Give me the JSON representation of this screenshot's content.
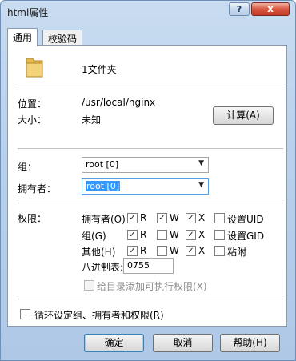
{
  "window": {
    "title": "html属性",
    "help_label": "?",
    "close_label": "x"
  },
  "tabs": [
    {
      "label": "通用"
    },
    {
      "label": "校验码"
    }
  ],
  "general": {
    "file_name": "1文件夹",
    "location_label": "位置：",
    "location_value": "/usr/local/nginx",
    "size_label": "大小：",
    "size_value": "未知",
    "calc_button": "计算(A)"
  },
  "ownership": {
    "group_label": "组：",
    "group_value": "root [0]",
    "owner_label": "拥有者：",
    "owner_value": "root [0]"
  },
  "permissions": {
    "label": "权限：",
    "rows": [
      {
        "label": "拥有者(O)",
        "r": true,
        "w": true,
        "x": true,
        "special_label": "设置UID",
        "special": false
      },
      {
        "label": "组(G)",
        "r": true,
        "w": false,
        "x": true,
        "special_label": "设置GID",
        "special": false
      },
      {
        "label": "其他(H)",
        "r": true,
        "w": false,
        "x": true,
        "special_label": "粘附",
        "special": false
      }
    ],
    "r_label": "R",
    "w_label": "W",
    "x_label": "X",
    "octal_label": "八进制表:",
    "octal_value": "0755",
    "add_exec_label": "给目录添加可执行权限(X)"
  },
  "recursive_label": "循环设定组、拥有者和权限(R)",
  "buttons": {
    "ok": "确定",
    "cancel": "取消",
    "help": "帮助(H)"
  }
}
